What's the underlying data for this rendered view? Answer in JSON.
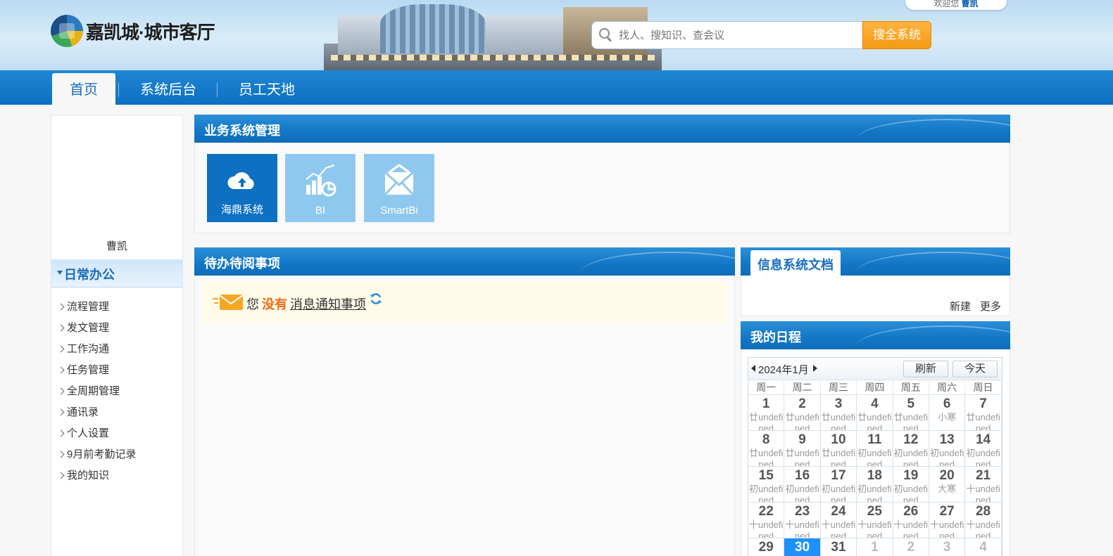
{
  "header": {
    "logo_text": "嘉凯城·城市客厅",
    "welcome_prefix": "欢迎您",
    "welcome_user": "曹凯",
    "search_placeholder": "找人、搜知识、查会议",
    "search_button": "搜全系统"
  },
  "nav": {
    "items": [
      {
        "label": "首页",
        "active": true
      },
      {
        "label": "系统后台",
        "active": false
      },
      {
        "label": "员工天地",
        "active": false
      }
    ]
  },
  "sidebar": {
    "user_name": "曹凯",
    "section_title": "日常办公",
    "items": [
      "流程管理",
      "发文管理",
      "工作沟通",
      "任务管理",
      "全周期管理",
      "通讯录",
      "个人设置",
      "9月前考勤记录",
      "我的知识"
    ]
  },
  "business": {
    "title": "业务系统管理",
    "tiles": [
      {
        "label": "海鼎系统",
        "icon": "cloud-upload-icon",
        "color": "#0d70c3"
      },
      {
        "label": "BI",
        "icon": "chart-icon",
        "color": "#8fc8ee"
      },
      {
        "label": "SmartBi",
        "icon": "mail-envelope-icon",
        "color": "#8fc8ee"
      }
    ]
  },
  "todo": {
    "title": "待办待阅事项",
    "text_you": "您",
    "text_none": "没有",
    "text_link": "消息通知事项"
  },
  "docs": {
    "title": "信息系统文档",
    "new_label": "新建",
    "more_label": "更多"
  },
  "schedule": {
    "title": "我的日程",
    "month_label": "2024年1月",
    "refresh_label": "刷新",
    "today_label": "今天",
    "weekdays": [
      "周一",
      "周二",
      "周三",
      "周四",
      "周五",
      "周六",
      "周日"
    ],
    "weeks": [
      [
        {
          "d": "1",
          "l": "廿undefined"
        },
        {
          "d": "2",
          "l": "廿undefined"
        },
        {
          "d": "3",
          "l": "廿undefined"
        },
        {
          "d": "4",
          "l": "廿undefined"
        },
        {
          "d": "5",
          "l": "廿undefined"
        },
        {
          "d": "6",
          "l": "小寒"
        },
        {
          "d": "7",
          "l": "廿undefined"
        }
      ],
      [
        {
          "d": "8",
          "l": "廿undefined"
        },
        {
          "d": "9",
          "l": "廿undefined"
        },
        {
          "d": "10",
          "l": "廿undefined"
        },
        {
          "d": "11",
          "l": "初undefined"
        },
        {
          "d": "12",
          "l": "初undefined"
        },
        {
          "d": "13",
          "l": "初undefined"
        },
        {
          "d": "14",
          "l": "初undefined"
        }
      ],
      [
        {
          "d": "15",
          "l": "初undefined"
        },
        {
          "d": "16",
          "l": "初undefined"
        },
        {
          "d": "17",
          "l": "初undefined"
        },
        {
          "d": "18",
          "l": "初undefined"
        },
        {
          "d": "19",
          "l": "初undefined"
        },
        {
          "d": "20",
          "l": "大寒"
        },
        {
          "d": "21",
          "l": "十undefined"
        }
      ],
      [
        {
          "d": "22",
          "l": "十undefined"
        },
        {
          "d": "23",
          "l": "十undefined"
        },
        {
          "d": "24",
          "l": "十undefined"
        },
        {
          "d": "25",
          "l": "十undefined"
        },
        {
          "d": "26",
          "l": "十undefined"
        },
        {
          "d": "27",
          "l": "十undefined"
        },
        {
          "d": "28",
          "l": "十undefined"
        }
      ],
      [
        {
          "d": "29",
          "l": ""
        },
        {
          "d": "30",
          "l": "",
          "today": true
        },
        {
          "d": "31",
          "l": ""
        },
        {
          "d": "1",
          "l": "",
          "other": true
        },
        {
          "d": "2",
          "l": "",
          "other": true
        },
        {
          "d": "3",
          "l": "",
          "other": true
        },
        {
          "d": "4",
          "l": "",
          "other": true
        }
      ]
    ]
  }
}
